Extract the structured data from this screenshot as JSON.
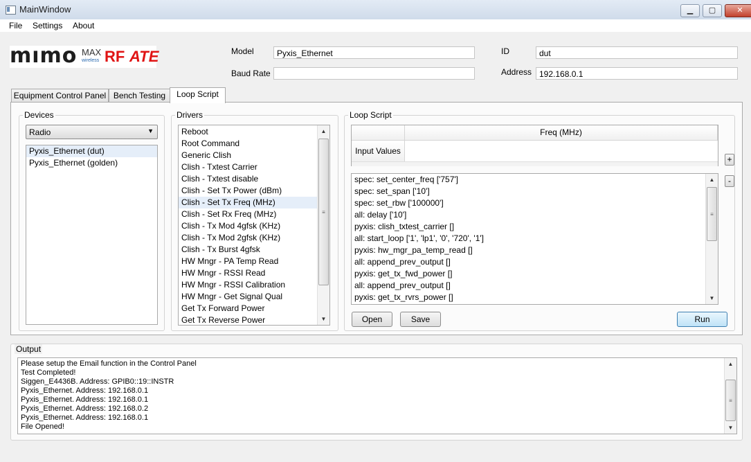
{
  "window": {
    "title": "MainWindow",
    "minimize": "▁",
    "maximize": "▢",
    "close": "✕"
  },
  "menu": [
    "File",
    "Settings",
    "About"
  ],
  "logo": {
    "mimo": "mımo",
    "max": "MAX",
    "wireless": "wireless",
    "rf": "RF",
    "ate": "ATE"
  },
  "fields": {
    "model_label": "Model",
    "model_value": "Pyxis_Ethernet",
    "baud_label": "Baud Rate",
    "baud_value": "",
    "id_label": "ID",
    "id_value": "dut",
    "address_label": "Address",
    "address_value": "192.168.0.1"
  },
  "tabs": [
    "Equipment Control Panel",
    "Bench Testing",
    "Loop Script"
  ],
  "active_tab": "Loop Script",
  "devices": {
    "title": "Devices",
    "combo_value": "Radio",
    "items": [
      "Pyxis_Ethernet (dut)",
      "Pyxis_Ethernet (golden)"
    ],
    "selected": "Pyxis_Ethernet (dut)"
  },
  "drivers": {
    "title": "Drivers",
    "items": [
      "Reboot",
      "Root Command",
      "Generic Clish",
      "Clish - Txtest Carrier",
      "Clish - Txtest disable",
      "Clish - Set Tx Power (dBm)",
      "Clish - Set Tx Freq (MHz)",
      "Clish - Set Rx Freq (MHz)",
      "Clish - Tx Mod 4gfsk (KHz)",
      "Clish - Tx Mod 2gfsk (KHz)",
      "Clish - Tx Burst 4gfsk",
      "HW Mngr - PA Temp Read",
      "HW Mngr - RSSI Read",
      "HW Mngr - RSSI Calibration",
      "HW Mngr - Get Signal Qual",
      "Get Tx Forward Power",
      "Get Tx Reverse Power"
    ],
    "selected": "Clish - Set Tx Freq (MHz)"
  },
  "loop_script": {
    "title": "Loop Script",
    "table_header": "Freq (MHz)",
    "table_row_label": "Input Values",
    "plus": "+",
    "minus": "-",
    "lines": [
      "spec: set_center_freq ['757']",
      "spec: set_span ['10']",
      "spec: set_rbw ['100000']",
      "all: delay ['10']",
      "pyxis: clish_txtest_carrier []",
      "all: start_loop ['1', 'lp1', '0', '720', '1']",
      "pyxis: hw_mgr_pa_temp_read []",
      "all: append_prev_output []",
      "pyxis: get_tx_fwd_power []",
      "all: append_prev_output []",
      "pyxis: get_tx_rvrs_power []"
    ],
    "open_label": "Open",
    "save_label": "Save",
    "run_label": "Run"
  },
  "output": {
    "title": "Output",
    "lines": [
      "Please setup the Email function in the Control Panel",
      "Test Completed!",
      "Siggen_E4436B. Address: GPIB0::19::INSTR",
      "Pyxis_Ethernet. Address: 192.168.0.1",
      "Pyxis_Ethernet. Address: 192.168.0.1",
      "Pyxis_Ethernet. Address: 192.168.0.2",
      "Pyxis_Ethernet. Address: 192.168.0.1",
      "File Opened!"
    ]
  },
  "icons": {
    "up": "▲",
    "down": "▼",
    "grip": "≡",
    "combo_arrow": "▼"
  }
}
